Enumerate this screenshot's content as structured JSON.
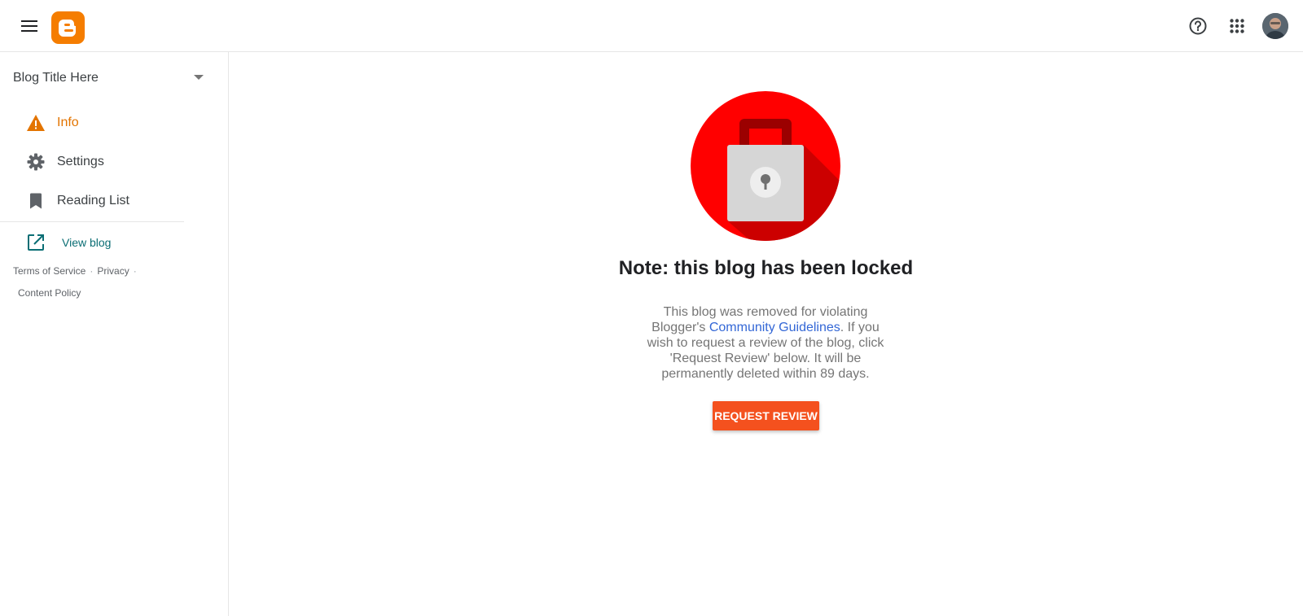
{
  "header": {
    "menu_icon": "hamburger-menu-icon",
    "logo_icon": "blogger-logo",
    "help_icon": "help-circle-icon",
    "apps_icon": "apps-grid-icon",
    "avatar": "user-avatar"
  },
  "sidebar": {
    "blog_title": "Blog Title Here",
    "items": [
      {
        "label": "Info",
        "icon": "warning-icon",
        "active": true
      },
      {
        "label": "Settings",
        "icon": "gear-icon",
        "active": false
      },
      {
        "label": "Reading List",
        "icon": "bookmark-icon",
        "active": false
      }
    ],
    "view_blog": {
      "label": "View blog",
      "icon": "open-in-new-icon"
    },
    "footer": {
      "terms": "Terms of Service",
      "privacy": "Privacy",
      "content_policy": "Content Policy"
    }
  },
  "main": {
    "title": "Note: this blog has been locked",
    "message_before": "This blog was removed for violating Blogger's ",
    "message_link": "Community Guidelines",
    "message_after": ". If you wish to request a review of the blog, click 'Request Review' below. It will be permanently deleted within 89 days.",
    "button_label": "REQUEST REVIEW"
  },
  "colors": {
    "accent_orange": "#f57d00",
    "active_nav": "#e37400",
    "view_blog_teal": "#0b6e74",
    "link_blue": "#3367d6",
    "button_orange": "#f4511e",
    "lock_red": "#ff0000"
  }
}
